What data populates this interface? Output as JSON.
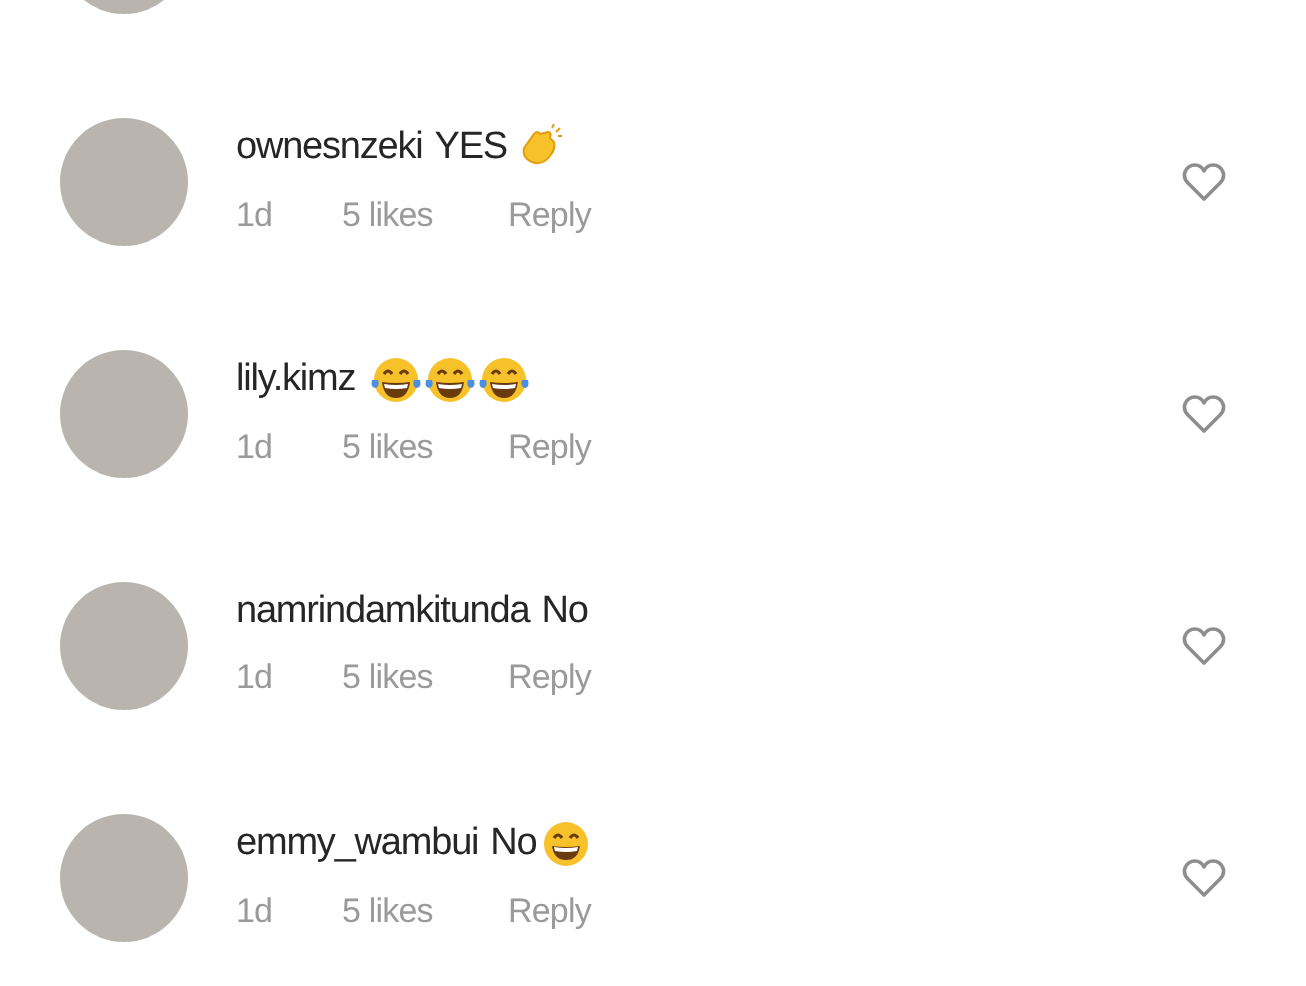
{
  "comments": [
    {
      "username": "ownesnzeki",
      "text": "YES",
      "reaction_icons": [
        {
          "kind": "clap"
        }
      ],
      "time": "1d",
      "likes": "5 likes",
      "reply": "Reply",
      "liked": false
    },
    {
      "username": "lily.kimz",
      "reaction_icons": [
        {
          "kind": "joy"
        },
        {
          "kind": "joy"
        },
        {
          "kind": "joy"
        }
      ],
      "time": "1d",
      "likes": "5 likes",
      "reply": "Reply",
      "liked": false
    },
    {
      "username": "namrindamkitunda",
      "text": "No",
      "time": "1d",
      "likes": "5 likes",
      "reply": "Reply",
      "liked": false
    },
    {
      "username": "emmy_wambui",
      "text": "No",
      "reaction_icons": [
        {
          "kind": "grin"
        }
      ],
      "time": "1d",
      "likes": "5 likes",
      "reply": "Reply",
      "liked": false
    }
  ]
}
